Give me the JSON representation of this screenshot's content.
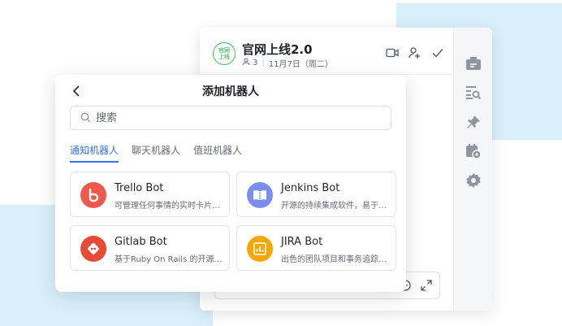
{
  "chat": {
    "avatar_text": "官网上线",
    "title": "官网上线2.0",
    "member_count": "3",
    "date": "11月7日（周二）"
  },
  "dialog": {
    "title": "添加机器人",
    "search_placeholder": "搜索",
    "tabs": [
      {
        "label": "通知机器人",
        "active": true
      },
      {
        "label": "聊天机器人",
        "active": false
      },
      {
        "label": "值班机器人",
        "active": false
      }
    ],
    "bots": [
      {
        "name": "Trello Bot",
        "desc": "可管理任何事情的实时卡片…",
        "icon": "trello-icon",
        "color": "#f0584c"
      },
      {
        "name": "Jenkins Bot",
        "desc": "开源的持续集成软件，易于…",
        "icon": "book-icon",
        "color": "#7b8ef0"
      },
      {
        "name": "Gitlab Bot",
        "desc": "基于Ruby On Rails 的开源…",
        "icon": "gitlab-icon",
        "color": "#e94a36"
      },
      {
        "name": "JIRA Bot",
        "desc": "出色的团队项目和事务追踪…",
        "icon": "chart-icon",
        "color": "#f7a700"
      }
    ]
  },
  "colors": {
    "accent": "#3370ff",
    "background_block": "#d9f0fb",
    "avatar_green": "#34c759"
  }
}
